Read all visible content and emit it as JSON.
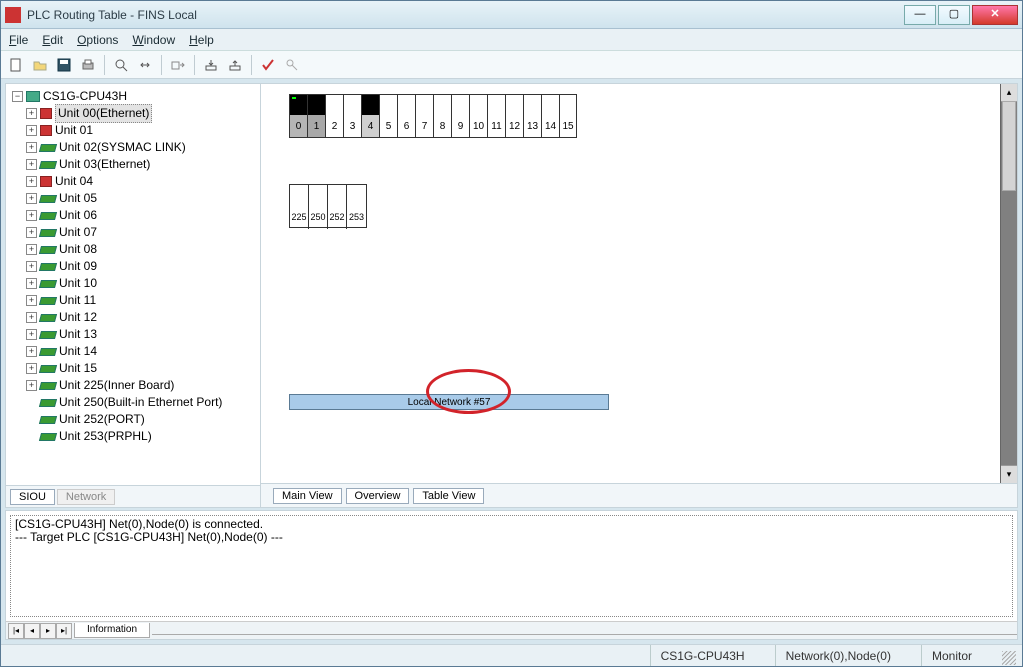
{
  "title": "PLC Routing Table - FINS Local",
  "menu": {
    "file": "File",
    "edit": "Edit",
    "options": "Options",
    "window": "Window",
    "help": "Help"
  },
  "tree": {
    "root": "CS1G-CPU43H",
    "items": [
      {
        "label": "Unit 00(Ethernet)",
        "icon": "red",
        "twisty": "+",
        "selected": true
      },
      {
        "label": "Unit 01",
        "icon": "red",
        "twisty": "+"
      },
      {
        "label": "Unit 02(SYSMAC LINK)",
        "icon": "grn",
        "twisty": "+"
      },
      {
        "label": "Unit 03(Ethernet)",
        "icon": "grn",
        "twisty": "+"
      },
      {
        "label": "Unit 04",
        "icon": "red",
        "twisty": "+"
      },
      {
        "label": "Unit 05",
        "icon": "grn",
        "twisty": "+"
      },
      {
        "label": "Unit 06",
        "icon": "grn",
        "twisty": "+"
      },
      {
        "label": "Unit 07",
        "icon": "grn",
        "twisty": "+"
      },
      {
        "label": "Unit 08",
        "icon": "grn",
        "twisty": "+"
      },
      {
        "label": "Unit 09",
        "icon": "grn",
        "twisty": "+"
      },
      {
        "label": "Unit 10",
        "icon": "grn",
        "twisty": "+"
      },
      {
        "label": "Unit 11",
        "icon": "grn",
        "twisty": "+"
      },
      {
        "label": "Unit 12",
        "icon": "grn",
        "twisty": "+"
      },
      {
        "label": "Unit 13",
        "icon": "grn",
        "twisty": "+"
      },
      {
        "label": "Unit 14",
        "icon": "grn",
        "twisty": "+"
      },
      {
        "label": "Unit 15",
        "icon": "grn",
        "twisty": "+"
      },
      {
        "label": "Unit 225(Inner Board)",
        "icon": "grn",
        "twisty": "+"
      },
      {
        "label": "Unit 250(Built-in Ethernet Port)",
        "icon": "grn",
        "twisty": ""
      },
      {
        "label": "Unit 252(PORT)",
        "icon": "grn",
        "twisty": ""
      },
      {
        "label": "Unit 253(PRPHL)",
        "icon": "grn",
        "twisty": ""
      }
    ]
  },
  "left_tabs": {
    "siou": "SIOU",
    "network": "Network"
  },
  "right_tabs": {
    "main": "Main View",
    "overview": "Overview",
    "table": "Table View"
  },
  "grid": {
    "slots": [
      "0",
      "1",
      "2",
      "3",
      "4",
      "5",
      "6",
      "7",
      "8",
      "9",
      "10",
      "11",
      "12",
      "13",
      "14",
      "15"
    ],
    "top_states": [
      "grn",
      "blk",
      "",
      "",
      "blk",
      "",
      "",
      "",
      "",
      "",
      "",
      "",
      "",
      "",
      "",
      ""
    ],
    "bottom_states": [
      "g1",
      "g3",
      "",
      "",
      "g2",
      "",
      "",
      "",
      "",
      "",
      "",
      "",
      "",
      "",
      "",
      ""
    ]
  },
  "extra_block": [
    "225",
    "250",
    "252",
    "253"
  ],
  "network_bar": "Local Network #57",
  "log": {
    "line1": "[CS1G-CPU43H] Net(0),Node(0) is connected.",
    "line2": "--- Target PLC [CS1G-CPU43H] Net(0),Node(0) ---",
    "tab": "Information"
  },
  "status": {
    "plc": "CS1G-CPU43H",
    "net": "Network(0),Node(0)",
    "mode": "Monitor"
  }
}
